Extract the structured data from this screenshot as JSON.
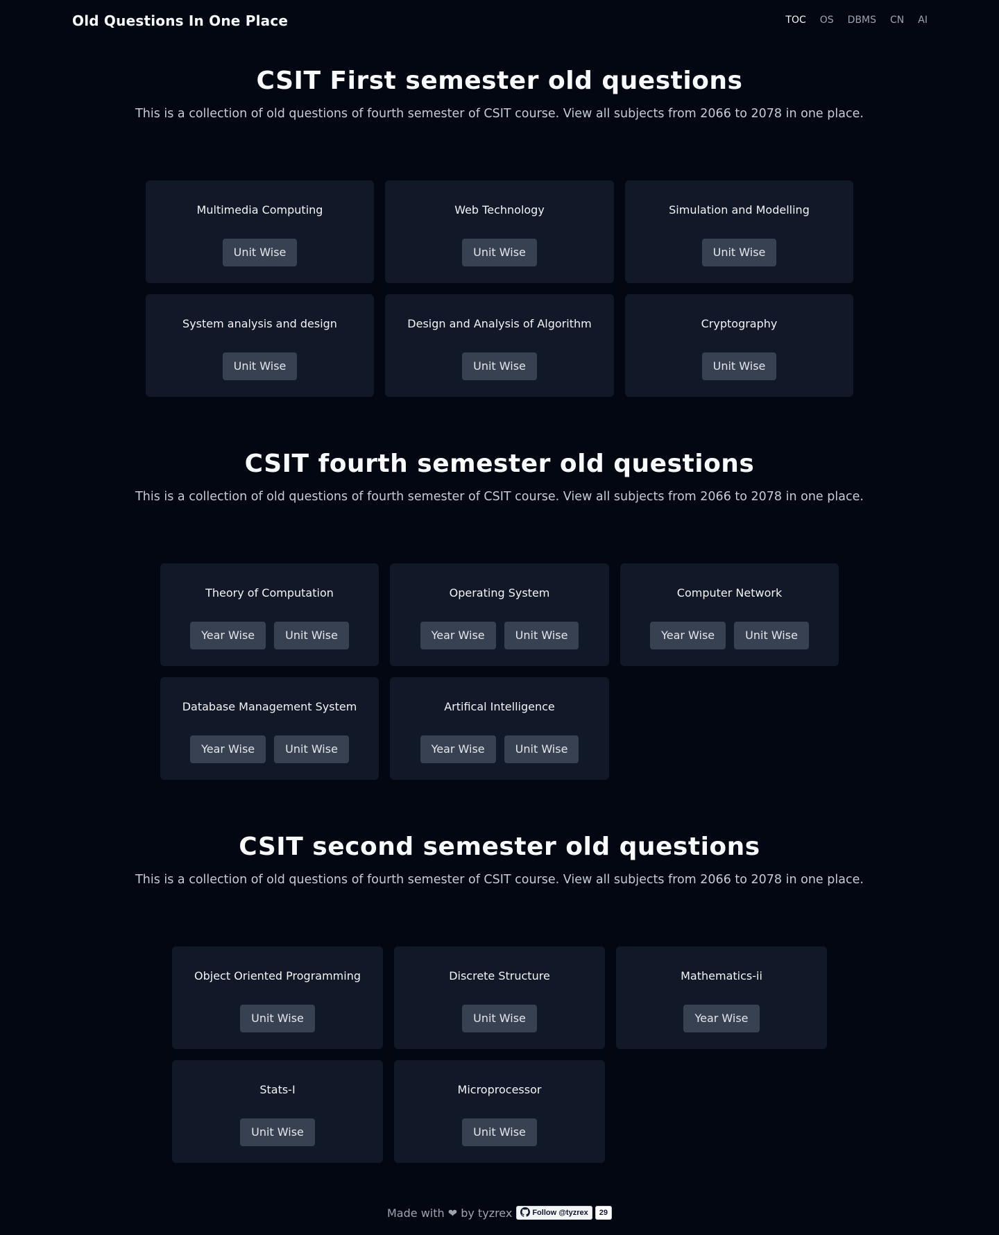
{
  "brand": "Old Questions In One Place",
  "nav": [
    {
      "label": "TOC",
      "active": true
    },
    {
      "label": "OS",
      "active": false
    },
    {
      "label": "DBMS",
      "active": false
    },
    {
      "label": "CN",
      "active": false
    },
    {
      "label": "AI",
      "active": false
    }
  ],
  "sections": [
    {
      "title": "CSIT First semester old questions",
      "description": "This is a collection of old questions of fourth semester of CSIT course. View all subjects from 2066 to 2078 in one place.",
      "cards": [
        {
          "title": "Multimedia Computing",
          "buttons": [
            "Unit Wise"
          ]
        },
        {
          "title": "Web Technology",
          "buttons": [
            "Unit Wise"
          ]
        },
        {
          "title": "Simulation and Modelling",
          "buttons": [
            "Unit Wise"
          ]
        },
        {
          "title": "System analysis and design",
          "buttons": [
            "Unit Wise"
          ]
        },
        {
          "title": "Design and Analysis of Algorithm",
          "buttons": [
            "Unit Wise"
          ]
        },
        {
          "title": "Cryptography",
          "buttons": [
            "Unit Wise"
          ]
        }
      ]
    },
    {
      "title": "CSIT fourth semester old questions",
      "description": "This is a collection of old questions of fourth semester of CSIT course. View all subjects from 2066 to 2078 in one place.",
      "cards": [
        {
          "title": "Theory of Computation",
          "buttons": [
            "Year Wise",
            "Unit Wise"
          ]
        },
        {
          "title": "Operating System",
          "buttons": [
            "Year Wise",
            "Unit Wise"
          ]
        },
        {
          "title": "Computer Network",
          "buttons": [
            "Year Wise",
            "Unit Wise"
          ]
        },
        {
          "title": "Database Management System",
          "buttons": [
            "Year Wise",
            "Unit Wise"
          ]
        },
        {
          "title": "Artifical Intelligence",
          "buttons": [
            "Year Wise",
            "Unit Wise"
          ]
        }
      ]
    },
    {
      "title": "CSIT second semester old questions",
      "description": "This is a collection of old questions of fourth semester of CSIT course. View all subjects from 2066 to 2078 in one place.",
      "cards": [
        {
          "title": "Object Oriented Programming",
          "buttons": [
            "Unit Wise"
          ]
        },
        {
          "title": "Discrete Structure",
          "buttons": [
            "Unit Wise"
          ]
        },
        {
          "title": "Mathematics-ii",
          "buttons": [
            "Year Wise"
          ]
        },
        {
          "title": "Stats-I",
          "buttons": [
            "Unit Wise"
          ]
        },
        {
          "title": "Microprocessor",
          "buttons": [
            "Unit Wise"
          ]
        }
      ]
    }
  ],
  "footer": {
    "text": "Made with ❤ by tyzrex",
    "follow_label": "Follow @tyzrex",
    "follow_count": "29"
  },
  "colors": {
    "background": "#030712",
    "card": "#111827",
    "button": "#374151",
    "text": "#f3f4f6",
    "muted": "#9ca3af"
  },
  "icons": {
    "github": "github-icon"
  }
}
